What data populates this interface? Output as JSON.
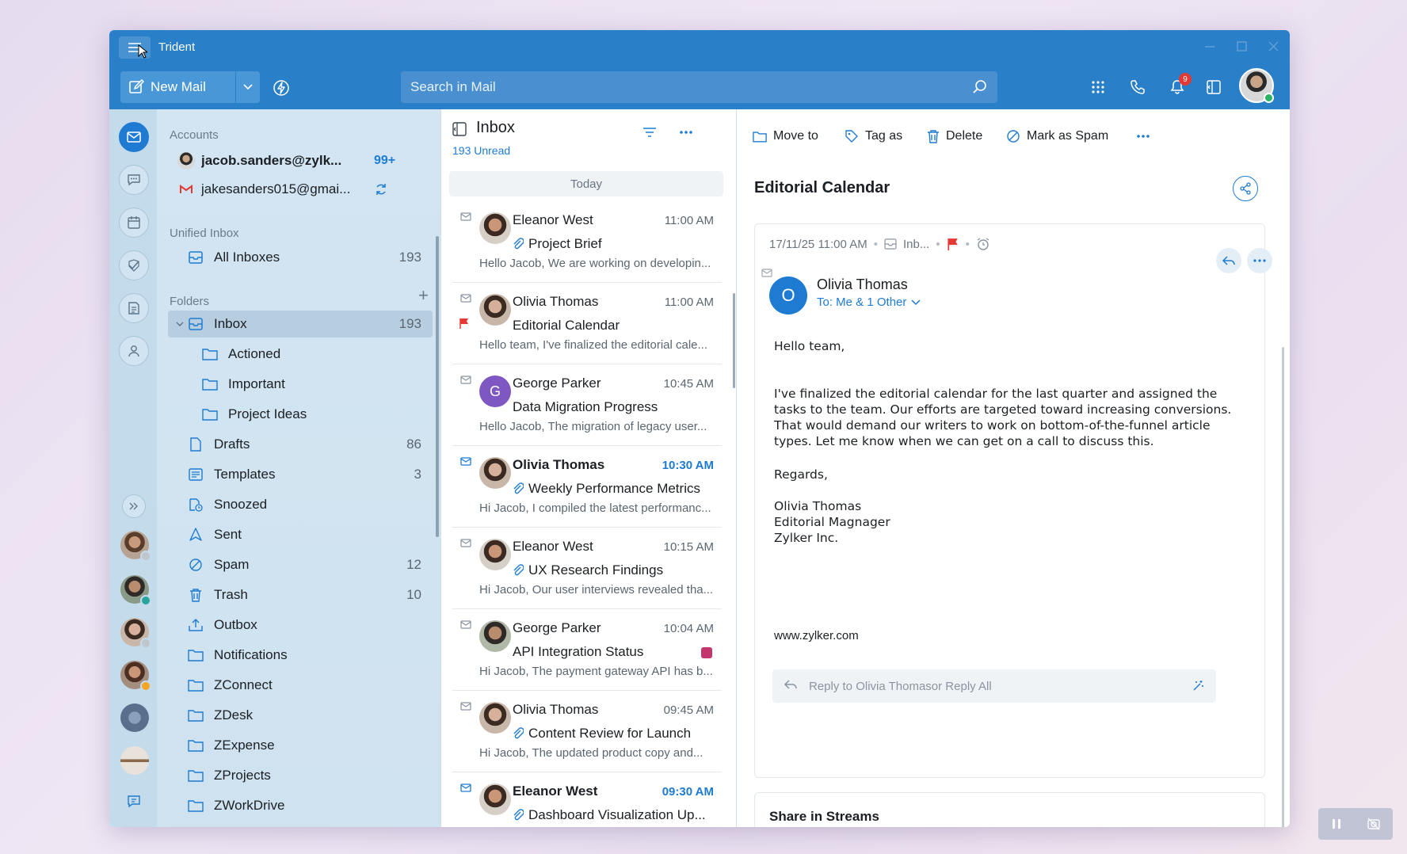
{
  "app": {
    "title": "Trident"
  },
  "toolbar": {
    "new_mail_label": "New Mail",
    "search_placeholder": "Search in Mail",
    "notification_count": "9"
  },
  "sidebar": {
    "accounts_label": "Accounts",
    "accounts": [
      {
        "email": "jacob.sanders@zylk...",
        "count": "99+"
      },
      {
        "email": "jakesanders015@gmai..."
      }
    ],
    "unified_inbox_label": "Unified Inbox",
    "all_inboxes": {
      "label": "All Inboxes",
      "count": "193"
    },
    "folders_label": "Folders",
    "folders": [
      {
        "label": "Inbox",
        "count": "193",
        "icon": "inbox-icon"
      },
      {
        "label": "Actioned",
        "icon": "folder-icon"
      },
      {
        "label": "Important",
        "icon": "folder-icon"
      },
      {
        "label": "Project Ideas",
        "icon": "folder-icon"
      },
      {
        "label": "Drafts",
        "count": "86",
        "icon": "draft-icon"
      },
      {
        "label": "Templates",
        "count": "3",
        "icon": "template-icon"
      },
      {
        "label": "Snoozed",
        "icon": "snooze-icon"
      },
      {
        "label": "Sent",
        "icon": "sent-icon"
      },
      {
        "label": "Spam",
        "count": "12",
        "icon": "spam-icon"
      },
      {
        "label": "Trash",
        "count": "10",
        "icon": "trash-icon"
      },
      {
        "label": "Outbox",
        "icon": "outbox-icon"
      },
      {
        "label": "Notifications",
        "icon": "folder-icon"
      },
      {
        "label": "ZConnect",
        "icon": "folder-icon"
      },
      {
        "label": "ZDesk",
        "icon": "folder-icon"
      },
      {
        "label": "ZExpense",
        "icon": "folder-icon"
      },
      {
        "label": "ZProjects",
        "icon": "folder-icon"
      },
      {
        "label": "ZWorkDrive",
        "icon": "folder-icon"
      }
    ]
  },
  "list": {
    "title": "Inbox",
    "unread_label": "193 Unread",
    "day_label": "Today",
    "mails": [
      {
        "sender": "Eleanor West",
        "time": "11:00 AM",
        "subject": "Project Brief",
        "preview": "Hello Jacob, We are working on developin...",
        "attachment": true,
        "unread": false
      },
      {
        "sender": "Olivia Thomas",
        "time": "11:00 AM",
        "subject": "Editorial Calendar",
        "preview": "Hello team, I've finalized the editorial cale...",
        "attachment": false,
        "flagged": true,
        "unread": false
      },
      {
        "sender": "George Parker",
        "time": "10:45 AM",
        "subject": "Data Migration Progress",
        "preview": "Hello Jacob, The migration of legacy user...",
        "attachment": false,
        "initial": "G",
        "unread": false
      },
      {
        "sender": "Olivia Thomas",
        "time": "10:30 AM",
        "subject": "Weekly Performance Metrics",
        "preview": "Hi Jacob, I compiled the latest performanc...",
        "attachment": true,
        "unread": true
      },
      {
        "sender": "Eleanor West",
        "time": "10:15 AM",
        "subject": "UX Research Findings",
        "preview": "Hi Jacob, Our user interviews revealed tha...",
        "attachment": true,
        "unread": false
      },
      {
        "sender": "George Parker",
        "time": "10:04 AM",
        "subject": "API Integration Status",
        "preview": "Hi Jacob, The payment gateway API has b...",
        "attachment": false,
        "tag_color": "#c2356f",
        "unread": false
      },
      {
        "sender": "Olivia Thomas",
        "time": "09:45 AM",
        "subject": "Content Review for Launch",
        "preview": "Hi Jacob, The updated product copy and...",
        "attachment": true,
        "unread": false
      },
      {
        "sender": "Eleanor West",
        "time": "09:30 AM",
        "subject": "Dashboard Visualization Up...",
        "preview": "",
        "attachment": true,
        "unread": true
      }
    ]
  },
  "reader": {
    "actions": {
      "move_to": "Move to",
      "tag_as": "Tag as",
      "delete": "Delete",
      "mark_spam": "Mark as Spam"
    },
    "subject": "Editorial Calendar",
    "date": "17/11/25 11:00 AM",
    "folder": "Inb...",
    "sender_initial": "O",
    "sender_name": "Olivia Thomas",
    "to_line": "To: Me & 1 Other",
    "body": {
      "greeting": "Hello team,",
      "paragraph": "I've finalized the editorial calendar for the last quarter and assigned the tasks to the team. Our efforts are targeted toward increasing conversions. That would demand our writers to work on bottom-of-the-funnel article types. Let me know when we can get on a call to discuss this.",
      "regards": "Regards,",
      "sig_name": "Olivia Thomas",
      "sig_title": "Editorial Magnager",
      "sig_company": "Zylker Inc.",
      "website": "www.zylker.com"
    },
    "reply_prefix": "Reply to Olivia Thomas",
    "reply_all": "or  Reply All",
    "share_in_streams": "Share in Streams"
  },
  "colors": {
    "accent": "#1e7bd1",
    "titlebar": "#2a7fc9",
    "flag": "#e53935"
  }
}
